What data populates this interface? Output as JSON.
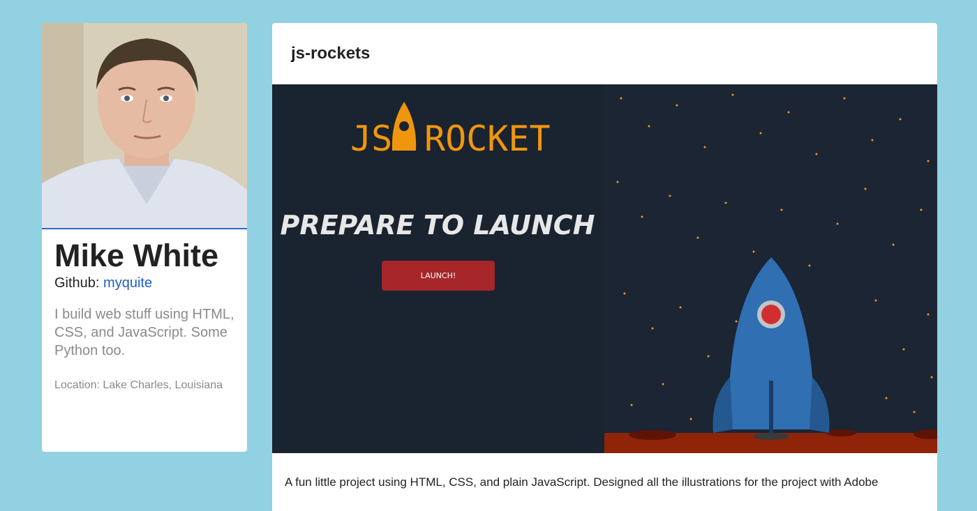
{
  "profile": {
    "name": "Mike White",
    "github_prefix": "Github: ",
    "github_link": "myquite",
    "bio": "I build web stuff using HTML, CSS, and JavaScript. Some Python too.",
    "location": "Location: Lake Charles, Louisiana"
  },
  "project": {
    "title": "js-rockets",
    "logo_left": "JS",
    "logo_right": "ROCKET",
    "headline": "PREPARE TO LAUNCH",
    "button_label": "LAUNCH!",
    "description": "A fun little project using HTML, CSS, and plain JavaScript. Designed all the illustrations for the project with Adobe"
  },
  "colors": {
    "page_bg": "#92d1e1",
    "accent_link": "#1f5cc4",
    "rocket_orange": "#f0960e",
    "launch_red": "#a6262a",
    "space_bg": "#1a2330",
    "mars_ground": "#8f2408"
  }
}
